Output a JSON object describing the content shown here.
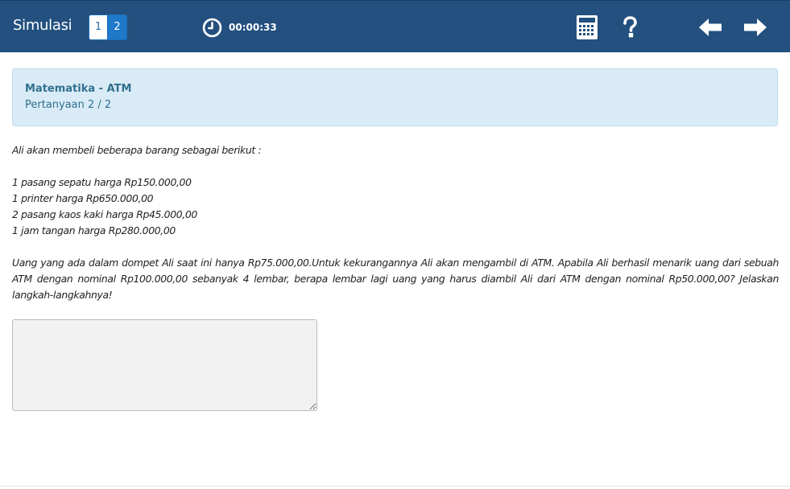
{
  "header": {
    "title": "Simulasi",
    "question_nav": [
      {
        "label": "1",
        "state": "answered"
      },
      {
        "label": "2",
        "state": "active"
      }
    ],
    "timer": "00:00:33",
    "icons": [
      "clock-icon",
      "calculator-icon",
      "help-icon",
      "arrow-left-icon",
      "arrow-right-icon"
    ]
  },
  "info": {
    "subject": "Matematika - ATM",
    "question_counter": "Pertanyaan 2 / 2"
  },
  "question": {
    "intro": "Ali akan membeli beberapa barang sebagai berikut :",
    "items": [
      "1 pasang sepatu harga Rp150.000,00",
      "1 printer harga Rp650.000,00",
      "2 pasang kaos kaki harga Rp45.000,00",
      "1 jam tangan harga Rp280.000,00"
    ],
    "body": "Uang yang ada dalam dompet Ali saat ini hanya Rp75.000,00.Untuk kekurangannya Ali akan mengambil di ATM. Apabila Ali berhasil menarik uang dari sebuah ATM dengan nominal Rp100.000,00 sebanyak 4 lembar, berapa lembar lagi uang yang harus diambil Ali dari ATM dengan nominal Rp50.000,00? Jelaskan langkah-langkahnya!"
  },
  "answer": {
    "value": "",
    "placeholder": ""
  },
  "colors": {
    "header_bg": "#23507f",
    "info_bg": "#d9ebf6",
    "info_text": "#31708f",
    "active_nav": "#1f78c8"
  }
}
